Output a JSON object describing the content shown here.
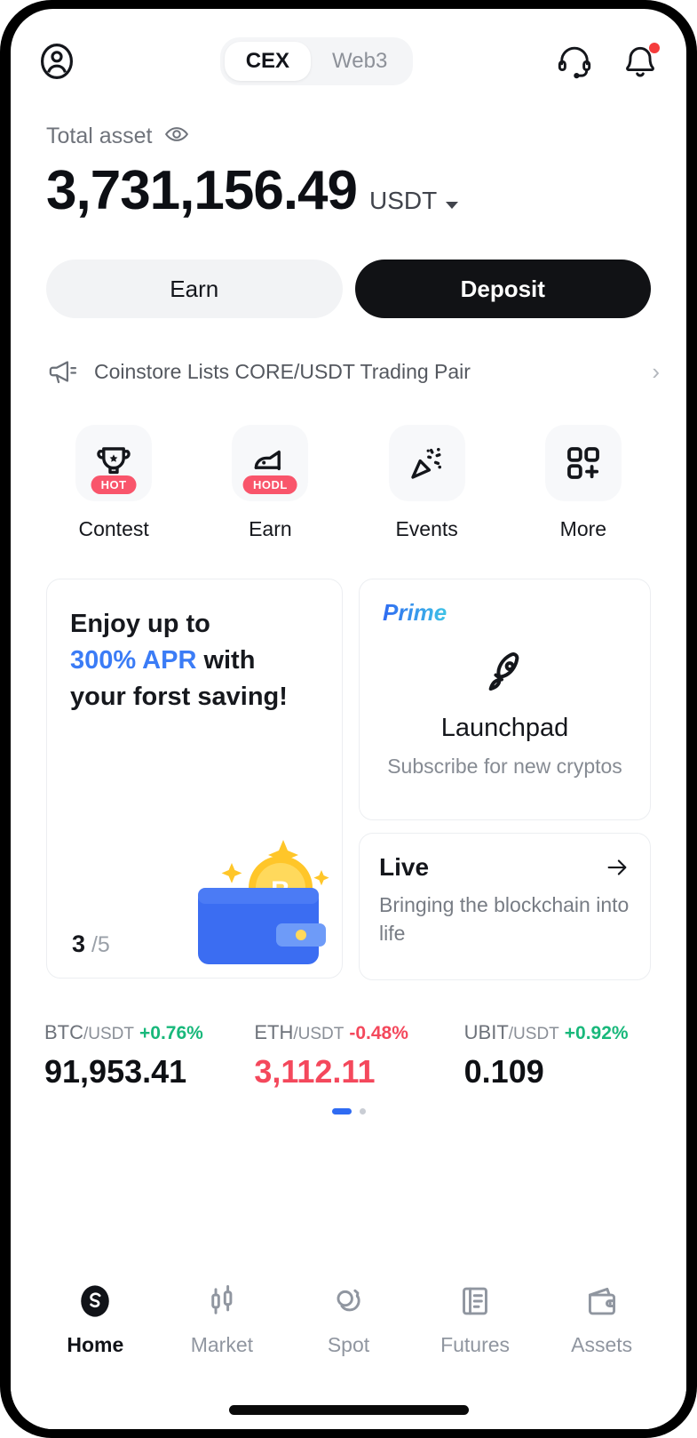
{
  "header": {
    "profile_icon": "user-circle-icon",
    "tabs": [
      {
        "label": "CEX",
        "active": true
      },
      {
        "label": "Web3",
        "active": false
      }
    ],
    "support_icon": "headset-icon",
    "notifications_icon": "bell-icon",
    "notifications_badge": true
  },
  "balance": {
    "label": "Total asset",
    "eye_icon": "eye-icon",
    "amount": "3,731,156.49",
    "currency": "USDT",
    "currency_caret": "chevron-down-icon"
  },
  "actions": {
    "earn_label": "Earn",
    "deposit_label": "Deposit"
  },
  "announcement": {
    "icon": "megaphone-icon",
    "text": "Coinstore Lists CORE/USDT Trading Pair",
    "chevron": "chevron-right-icon"
  },
  "quick_menu": [
    {
      "label": "Contest",
      "icon": "trophy-icon",
      "badge": "HOT"
    },
    {
      "label": "Earn",
      "icon": "piggy-bank-icon",
      "badge": "HODL"
    },
    {
      "label": "Events",
      "icon": "party-popper-icon",
      "badge": ""
    },
    {
      "label": "More",
      "icon": "grid-plus-icon",
      "badge": ""
    }
  ],
  "promo": {
    "line1": "Enjoy up to",
    "accent": "300% APR",
    "line2_tail": " with",
    "line3": "your forst saving!",
    "pager_current": "3",
    "pager_total": "/5",
    "art_icon": "wallet-with-bitcoin-icon"
  },
  "launchpad": {
    "tag": "Prime",
    "icon": "rocket-icon",
    "title": "Launchpad",
    "subtitle": "Subscribe for new cryptos"
  },
  "live": {
    "title": "Live",
    "arrow_icon": "arrow-right-icon",
    "subtitle": "Bringing the blockchain into life"
  },
  "tickers": [
    {
      "symbol": "BTC",
      "quote": "/USDT",
      "change": "+0.76%",
      "direction": "up",
      "price": "91,953.41",
      "price_color": "neutral"
    },
    {
      "symbol": "ETH",
      "quote": "/USDT",
      "change": "-0.48%",
      "direction": "down",
      "price": "3,112.11",
      "price_color": "down"
    },
    {
      "symbol": "UBIT",
      "quote": "/USDT",
      "change": "+0.92%",
      "direction": "up",
      "price": "0.109",
      "price_color": "neutral"
    }
  ],
  "carousel": {
    "active_index": 0,
    "count": 2
  },
  "bottom_nav": [
    {
      "label": "Home",
      "icon": "logo-s-icon",
      "active": true
    },
    {
      "label": "Market",
      "icon": "candlestick-icon",
      "active": false
    },
    {
      "label": "Spot",
      "icon": "spot-circles-icon",
      "active": false
    },
    {
      "label": "Futures",
      "icon": "document-chart-icon",
      "active": false
    },
    {
      "label": "Assets",
      "icon": "wallet-icon",
      "active": false
    }
  ],
  "colors": {
    "accent_blue": "#3b7cf6",
    "up_green": "#18b87b",
    "down_red": "#f4485c",
    "badge_red": "#f9556b",
    "primary_black": "#111215"
  }
}
